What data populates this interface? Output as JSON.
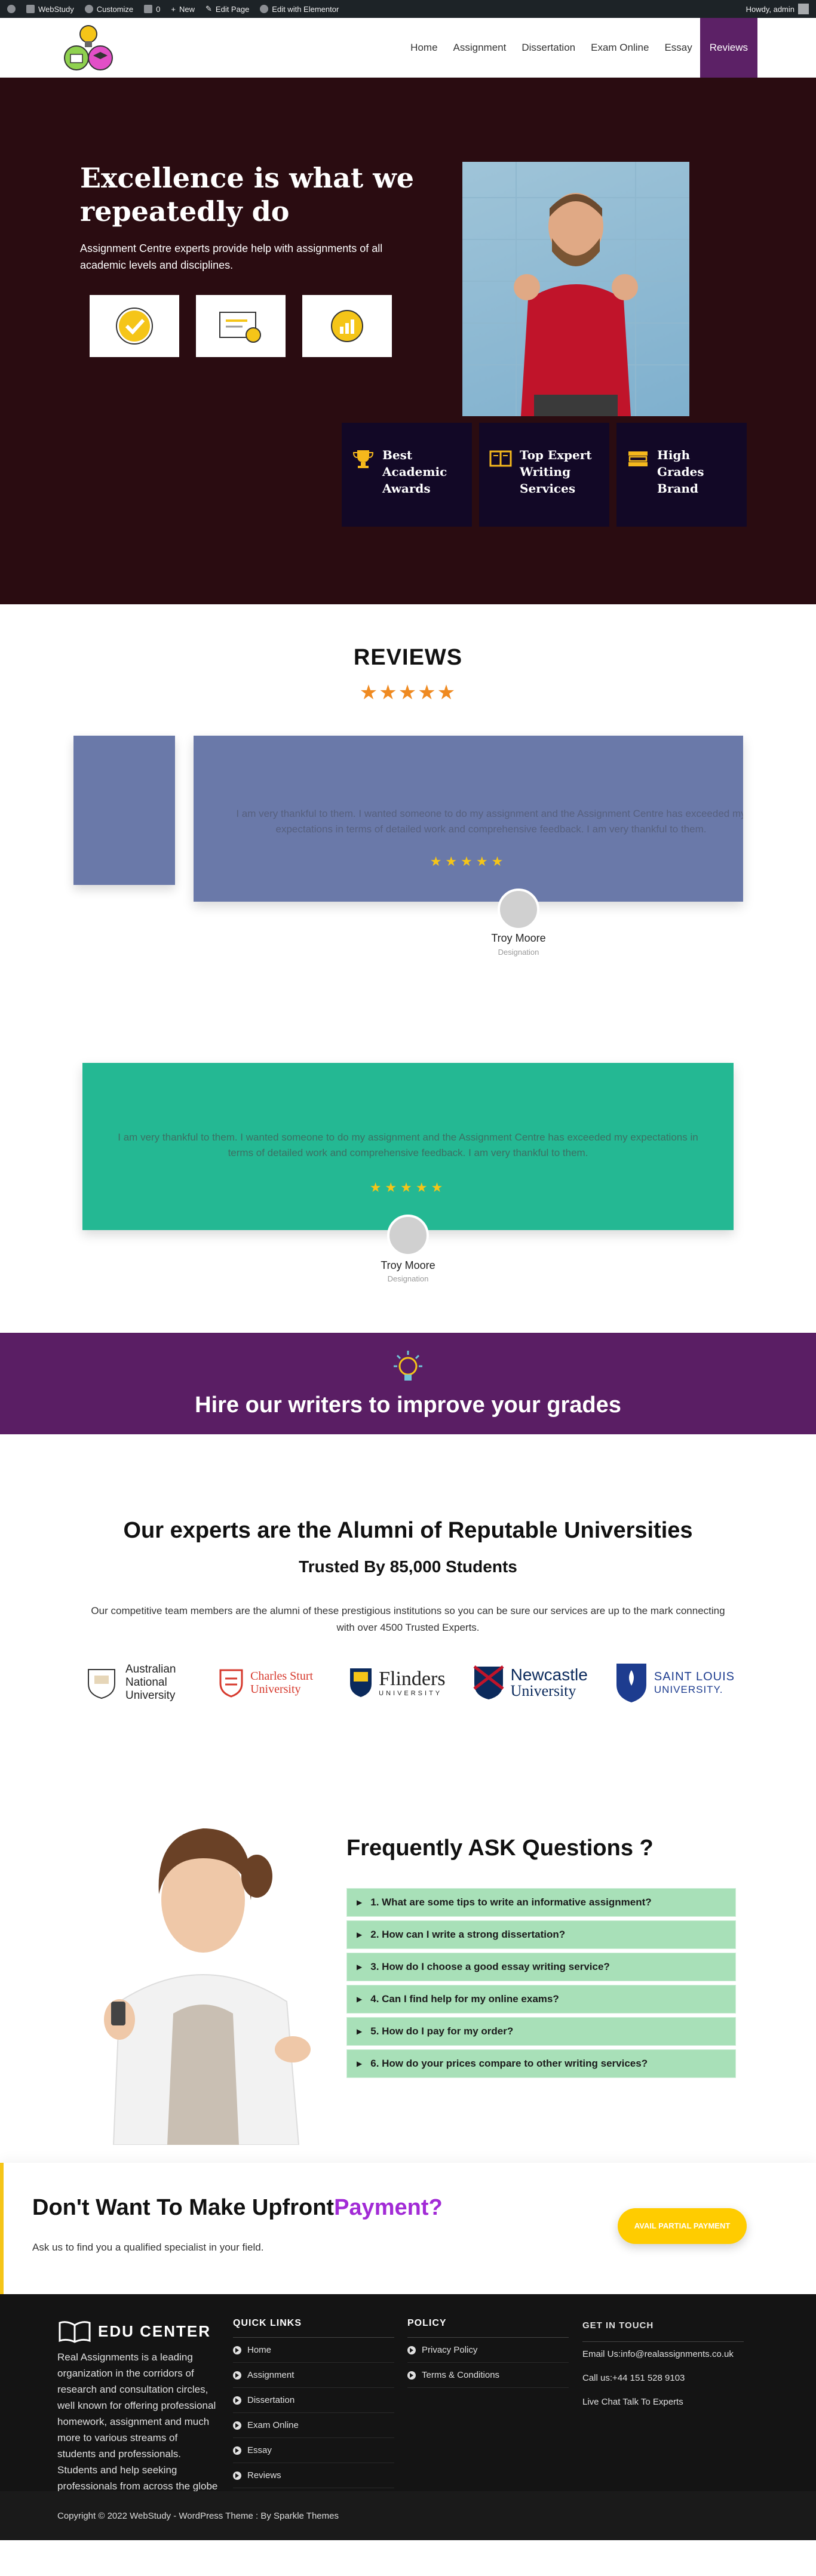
{
  "adminbar": {
    "site": "WebStudy",
    "customize": "Customize",
    "comments": "0",
    "new": "New",
    "edit_page": "Edit Page",
    "elementor": "Edit with Elementor",
    "howdy": "Howdy, admin"
  },
  "nav": {
    "items": [
      "Home",
      "Assignment",
      "Dissertation",
      "Exam Online",
      "Essay",
      "Reviews"
    ],
    "active": "Reviews"
  },
  "hero": {
    "title": "Excellence is what we repeatedly do",
    "text": "Assignment Centre experts provide help with assignments of all academic levels and disciplines.",
    "features": [
      "Best Academic Awards",
      "Top Expert Writing Services",
      "High Grades Brand"
    ]
  },
  "reviews": {
    "title": "REVIEWS",
    "stars": "★★★★★",
    "items": [
      {
        "text": "I am very thankful to them. I wanted someone to do my assignment and the Assignment Centre has exceeded my expectations in terms of detailed work and comprehensive feedback. I am very thankful to them.",
        "stars": "★★★★★",
        "name": "Troy Moore",
        "designation": "Designation"
      },
      {
        "text": "I am very thankful to them. I wanted someone to do my assignment and the Assignment Centre has exceeded my expectations in terms of detailed work and comprehensive feedback. I am very thankful to them.",
        "stars": "★★★★★",
        "name": "Troy Moore",
        "designation": "Designation"
      }
    ]
  },
  "hire": {
    "title": "Hire our writers to improve your grades"
  },
  "alumni": {
    "title": "Our experts are the Alumni of Reputable Universities",
    "subtitle": "Trusted By 85,000 Students",
    "text": "Our competitive team members are the alumni of these prestigious institutions so you can be sure our services are up to the mark connecting with over 4500 Trusted Experts.",
    "universities": {
      "anu": "Australian National University",
      "csu": "Charles Sturt University",
      "flinders": "Flinders",
      "flinders_sub": "UNIVERSITY",
      "newcastle": "Newcastle",
      "newcastle_sub": "University",
      "slu": "SAINT LOUIS",
      "slu_sub": "UNIVERSITY."
    }
  },
  "faq": {
    "title": "Frequently ASK Questions ?",
    "items": [
      "1. What are some tips to write an informative assignment?",
      "2. How can I write a strong dissertation?",
      "3. How do I choose a good essay writing service?",
      "4. Can I find help for my online exams?",
      "5. How do I pay for my order?",
      "6. How do your prices compare to other writing services?"
    ]
  },
  "cta": {
    "title_main": "Don't Want To Make Upfront",
    "title_highlight": "Payment?",
    "text": "Ask us to find you a qualified specialist in your field.",
    "button": "AVAIL PARTIAL PAYMENT"
  },
  "footer": {
    "brand": "EDU CENTER",
    "description": "Real Assignments is a leading organization in the corridors of research and consultation circles, well known for offering professional homework, assignment and much more to various streams of students and professionals. Students and help seeking professionals from across the globe are taking advantage of our solutions.",
    "quick_links_title": "QUICK LINKS",
    "quick_links": [
      "Home",
      "Assignment",
      "Dissertation",
      "Exam Online",
      "Essay",
      "Reviews"
    ],
    "policy_title": "POLICY",
    "policy_links": [
      "Privacy Policy",
      "Terms & Conditions"
    ],
    "touch_title": "GET IN TOUCH",
    "touch": [
      "Email Us:info@realassignments.co.uk",
      "Call us:+44 151 528 9103",
      "Live Chat Talk To Experts"
    ],
    "copyright": "Copyright © 2022 WebStudy - WordPress Theme : By Sparkle Themes"
  },
  "colors": {
    "hero_bg": "#2a0c11",
    "nav_active": "#5c2166",
    "feature_bg": "#120826",
    "review_card_1": "#6a79a9",
    "review_card_2": "#24b893",
    "hire_bg": "#5a1e64",
    "faq_item": "#a8e0b8",
    "cta_button": "#ffcc00",
    "cta_highlight": "#a22bd6",
    "footer_bg": "#141414"
  }
}
